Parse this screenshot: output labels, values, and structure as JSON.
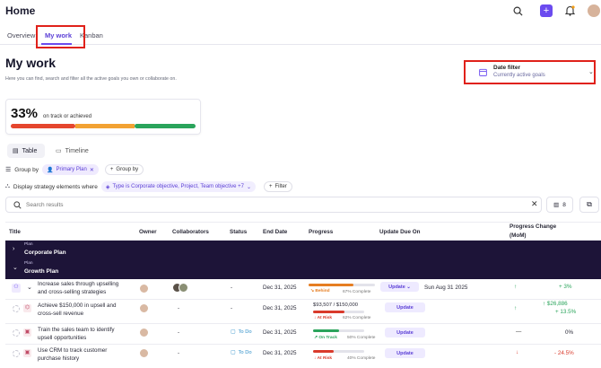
{
  "header": {
    "title": "Home"
  },
  "tabs": [
    {
      "label": "Overview"
    },
    {
      "label": "My work"
    },
    {
      "label": "Kanban"
    }
  ],
  "page": {
    "title": "My work",
    "subtitle": "Here you can find, search and filter all the active goals you own or collaborate on."
  },
  "date_filter": {
    "title": "Date filter",
    "subtitle": "Currently active goals"
  },
  "summary": {
    "percent": "33%",
    "label": "on track or achieved"
  },
  "view_tabs": {
    "table": "Table",
    "timeline": "Timeline"
  },
  "group_by": {
    "label": "Group by",
    "chip": "Primary Plan",
    "add": "Group by"
  },
  "strategy": {
    "label": "Display strategy elements where",
    "chip": "Type is Corporate objective, Project, Team objective +7",
    "filter": "Filter"
  },
  "search": {
    "placeholder": "Search results",
    "count": "8"
  },
  "columns": {
    "title": "Title",
    "owner": "Owner",
    "collaborators": "Collaborators",
    "status": "Status",
    "end_date": "End Date",
    "progress": "Progress",
    "update_due": "Update Due On",
    "change_line1": "Progress Change",
    "change_line2": "(MoM)"
  },
  "plans": [
    {
      "small": "Plan",
      "name": "Corporate Plan"
    },
    {
      "small": "Plan",
      "name": "Growth Plan"
    }
  ],
  "rows": [
    {
      "title1": "Increase sales through upselling",
      "title2": "and cross-selling strategies",
      "status": "-",
      "end_date": "Dec 31, 2025",
      "progress_status": "Behind",
      "progress_caption": "67% Complete",
      "progress": 0.67,
      "update": "Update",
      "due": "Sun Aug 31 2025",
      "change1": "+ 3%",
      "change2": ""
    },
    {
      "title1": "Achieve $150,000 in upsell and",
      "title2": "cross-sell revenue",
      "status": "-",
      "end_date": "Dec 31, 2025",
      "progress_status": "At Risk",
      "progress_caption": "62% Complete",
      "progress_value": "$93,507 / $150,000",
      "progress": 0.62,
      "update": "Update",
      "due": "",
      "change1": "↑ $26,886",
      "change2": "+ 13.5%"
    },
    {
      "title1": "Train the sales team to identify",
      "title2": "upsell opportunities",
      "status": "To Do",
      "end_date": "Dec 31, 2025",
      "progress_status": "On Track",
      "progress_caption": "50% Complete",
      "progress": 0.5,
      "update": "Update",
      "due": "",
      "change1": "0%",
      "change2": ""
    },
    {
      "title1": "Use CRM to track customer",
      "title2": "purchase history",
      "status": "To Do",
      "end_date": "Dec 31, 2025",
      "progress_status": "At Risk",
      "progress_caption": "40% Complete",
      "progress": 0.4,
      "update": "Update",
      "due": "",
      "change1": "- 24.5%",
      "change2": ""
    }
  ],
  "colors": {
    "accent": "#6b4bef",
    "behind": "#e67e22",
    "at_risk": "#d93a2b",
    "on_track": "#2aa45b",
    "plan_bg": "#1d1438"
  }
}
